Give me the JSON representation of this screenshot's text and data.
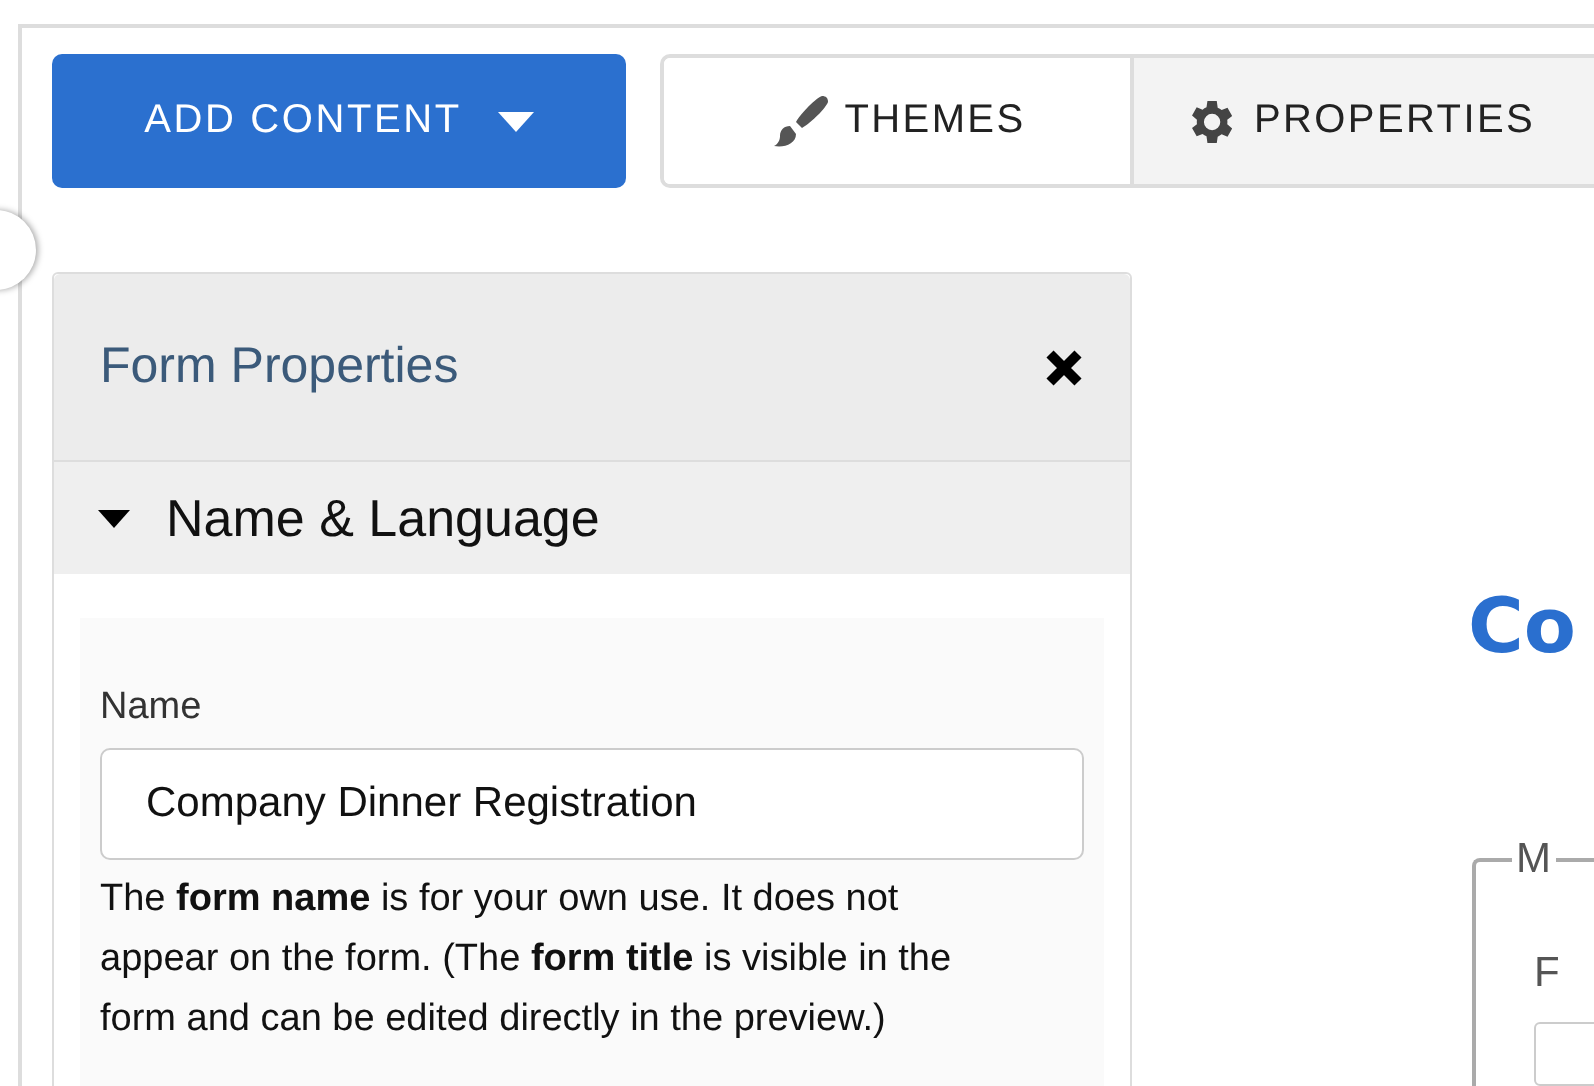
{
  "toolbar": {
    "add_button": "ADD CONTENT",
    "tabs": [
      {
        "label": "THEMES",
        "selected": false
      },
      {
        "label": "PROPERTIES",
        "selected": true
      }
    ]
  },
  "panel": {
    "title": "Form Properties",
    "sections": [
      {
        "title": "Name & Language",
        "expanded": true,
        "fields": [
          {
            "label": "Name",
            "value": "Company Dinner Registration",
            "help": "The **form name** is for your own use. It does not appear on the form. (The **form title** is visible in the form and can be edited directly in the preview.)"
          }
        ]
      }
    ]
  },
  "preview": {
    "title": "Co",
    "fieldset_legend": "M",
    "field_label": "F"
  }
}
